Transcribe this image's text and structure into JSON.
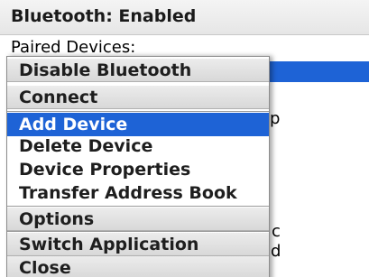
{
  "screen": {
    "title": "Bluetooth: Enabled",
    "paired_label": "Paired Devices:",
    "peek_texts": [
      "p",
      "c",
      "d"
    ]
  },
  "menu": {
    "items": [
      {
        "label": "Disable Bluetooth"
      },
      {
        "label": "Connect"
      },
      {
        "label": "Add Device",
        "selected": true
      },
      {
        "label": "Delete Device"
      },
      {
        "label": "Device Properties"
      },
      {
        "label": "Transfer Address Book"
      },
      {
        "label": "Options"
      },
      {
        "label": "Switch Application"
      },
      {
        "label": "Close"
      }
    ]
  },
  "colors": {
    "highlight": "#1e63d6",
    "menu_band": "#e0e0e0"
  }
}
